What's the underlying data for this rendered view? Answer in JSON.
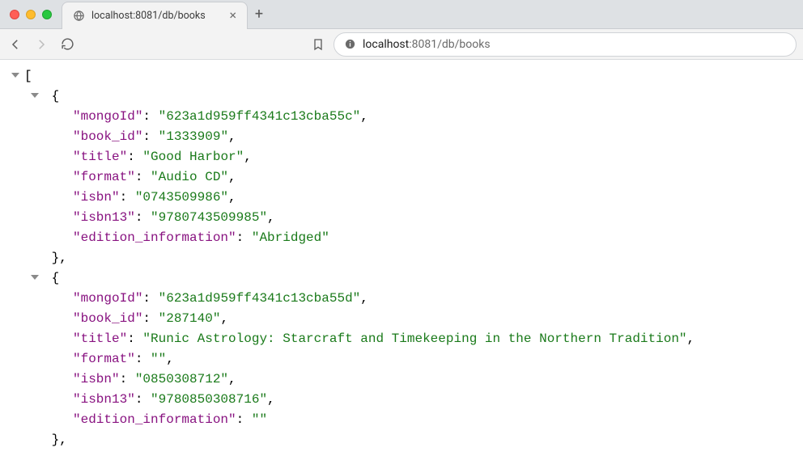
{
  "tab": {
    "title": "localhost:8081/db/books"
  },
  "address": {
    "host": "localhost",
    "path": ":8081/db/books"
  },
  "json": {
    "records": [
      {
        "mongoId": "623a1d959ff4341c13cba55c",
        "book_id": "1333909",
        "title": "Good Harbor",
        "format": "Audio CD",
        "isbn": "0743509986",
        "isbn13": "9780743509985",
        "edition_information": "Abridged"
      },
      {
        "mongoId": "623a1d959ff4341c13cba55d",
        "book_id": "287140",
        "title": "Runic Astrology: Starcraft and Timekeeping in the Northern Tradition",
        "format": "",
        "isbn": "0850308712",
        "isbn13": "9780850308716",
        "edition_information": ""
      }
    ],
    "keys": [
      "mongoId",
      "book_id",
      "title",
      "format",
      "isbn",
      "isbn13",
      "edition_information"
    ]
  }
}
